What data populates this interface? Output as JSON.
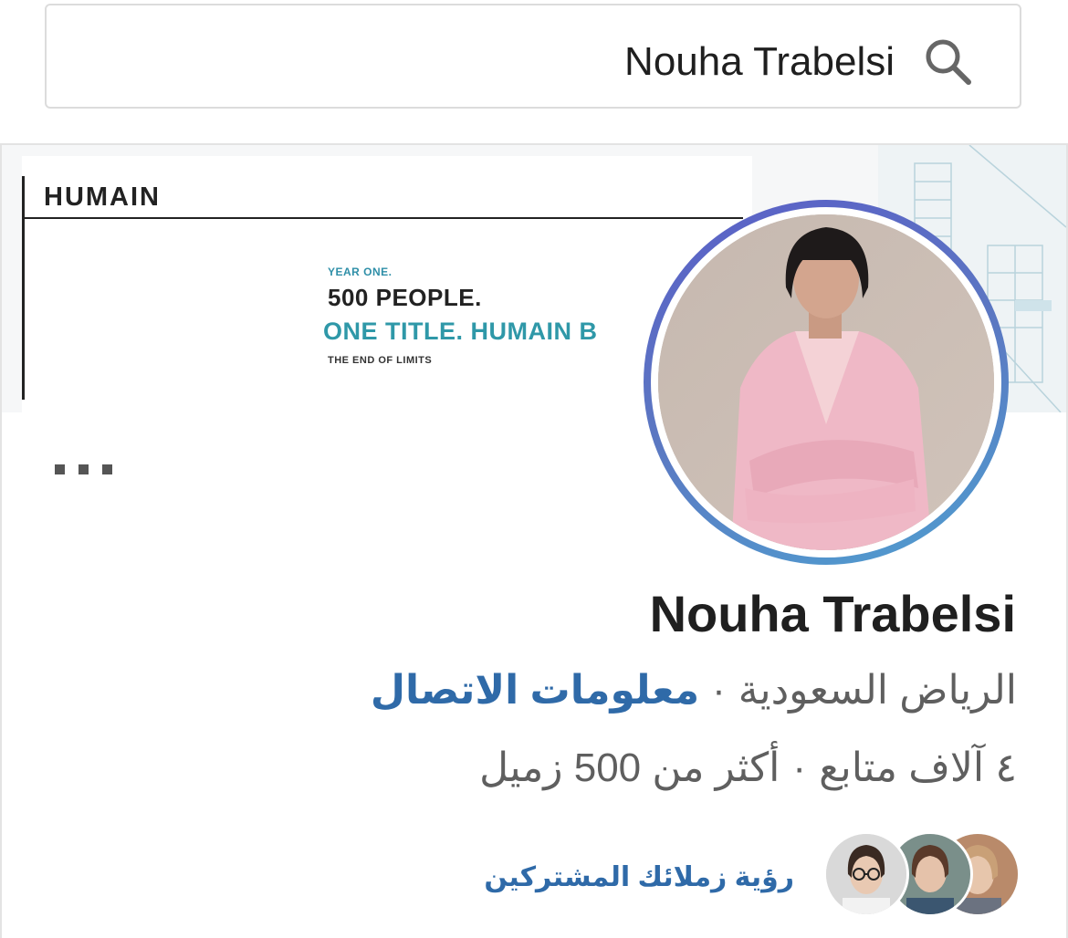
{
  "search": {
    "query": "Nouha Trabelsi"
  },
  "banner": {
    "logo": "HUMAIN",
    "year_line": "YEAR ONE.",
    "people_line": "500 PEOPLE.",
    "title_line": "ONE TITLE. HUMAIN B",
    "tagline": "THE END OF LIMITS"
  },
  "profile": {
    "name": "Nouha Trabelsi",
    "location": "الرياض السعودية",
    "separator": "·",
    "contact_info": "معلومات الاتصال",
    "followers": "٤ آلاف متابع",
    "connections": "أكثر من 500 زميل",
    "mutual_link": "رؤية زملائك المشتركين"
  },
  "colors": {
    "link": "#2f6aa8",
    "ring_start": "#5b5fc7",
    "ring_end": "#4f9fd0"
  }
}
